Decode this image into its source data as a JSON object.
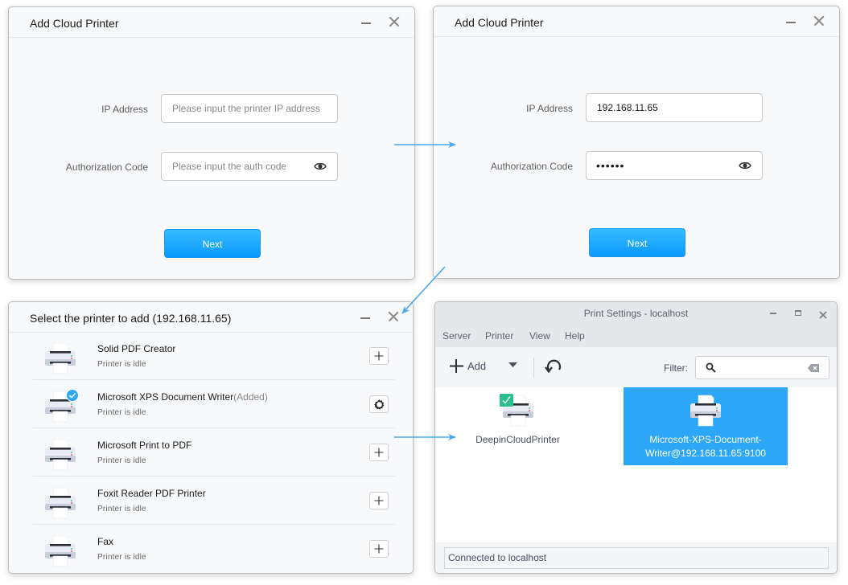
{
  "dialog_empty": {
    "title": "Add Cloud Printer",
    "ip_label": "IP Address",
    "ip_placeholder": "Please input the printer IP address",
    "auth_label": "Authorization Code",
    "auth_placeholder": "Please input the auth code",
    "next_label": "Next"
  },
  "dialog_filled": {
    "title": "Add Cloud Printer",
    "ip_label": "IP Address",
    "ip_value": "192.168.11.65",
    "auth_label": "Authorization Code",
    "auth_value": "••••••",
    "next_label": "Next"
  },
  "select_dialog": {
    "title": "Select the printer to add (192.168.11.65)",
    "printers": [
      {
        "name": "Solid PDF Creator",
        "suffix": "",
        "status": "Printer is idle",
        "action": "add"
      },
      {
        "name": "Microsoft XPS Document Writer",
        "suffix": "(Added)",
        "status": "Printer is idle",
        "action": "settings"
      },
      {
        "name": "Microsoft Print to PDF",
        "suffix": "",
        "status": "Printer is idle",
        "action": "add"
      },
      {
        "name": "Foxit Reader PDF Printer",
        "suffix": "",
        "status": "Printer is idle",
        "action": "add"
      },
      {
        "name": "Fax",
        "suffix": "",
        "status": "Printer is idle",
        "action": "add"
      }
    ]
  },
  "print_settings": {
    "title": "Print Settings - localhost",
    "menu": [
      "Server",
      "Printer",
      "View",
      "Help"
    ],
    "toolbar": {
      "add_label": "Add",
      "filter_label": "Filter:",
      "filter_value": ""
    },
    "printers": [
      {
        "name": "DeepinCloudPrinter",
        "default": true,
        "selected": false
      },
      {
        "name": "Microsoft-XPS-Document-Writer@192.168.11.65:9100",
        "name_line1": "Microsoft-XPS-Document-",
        "name_line2": "Writer@192.168.11.65:9100",
        "default": false,
        "selected": true
      }
    ],
    "status": "Connected to localhost"
  },
  "colors": {
    "accent": "#2ca7f8",
    "arrow": "#4aa8f0",
    "next_button": "#0a9afc",
    "default_badge": "#2bbf8f"
  }
}
